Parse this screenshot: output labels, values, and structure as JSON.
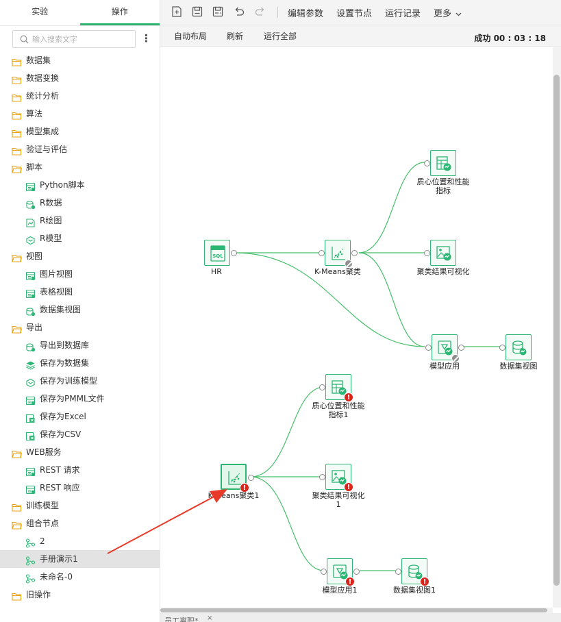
{
  "tabs": [
    "实验",
    "操作"
  ],
  "search": {
    "placeholder": "输入搜索文字"
  },
  "tree": [
    {
      "label": "数据集",
      "icon": "folder-icon",
      "level": 0
    },
    {
      "label": "数据变换",
      "icon": "folder-icon",
      "level": 0
    },
    {
      "label": "统计分析",
      "icon": "folder-icon",
      "level": 0
    },
    {
      "label": "算法",
      "icon": "folder-icon",
      "level": 0
    },
    {
      "label": "模型集成",
      "icon": "folder-icon",
      "level": 0
    },
    {
      "label": "验证与评估",
      "icon": "folder-icon",
      "level": 0
    },
    {
      "label": "脚本",
      "icon": "folder-open-icon",
      "level": 0
    },
    {
      "label": "Python脚本",
      "icon": "python-script-icon",
      "level": 1
    },
    {
      "label": "R数据",
      "icon": "r-data-icon",
      "level": 1
    },
    {
      "label": "R绘图",
      "icon": "r-plot-icon",
      "level": 1
    },
    {
      "label": "R模型",
      "icon": "r-model-icon",
      "level": 1
    },
    {
      "label": "视图",
      "icon": "folder-open-icon",
      "level": 0
    },
    {
      "label": "图片视图",
      "icon": "image-view-icon",
      "level": 1
    },
    {
      "label": "表格视图",
      "icon": "table-view-icon",
      "level": 1
    },
    {
      "label": "数据集视图",
      "icon": "dataset-view-icon",
      "level": 1
    },
    {
      "label": "导出",
      "icon": "folder-open-icon",
      "level": 0
    },
    {
      "label": "导出到数据库",
      "icon": "export-db-icon",
      "level": 1
    },
    {
      "label": "保存为数据集",
      "icon": "save-dataset-icon",
      "level": 1
    },
    {
      "label": "保存为训练模型",
      "icon": "save-model-icon",
      "level": 1
    },
    {
      "label": "保存为PMML文件",
      "icon": "save-pmml-icon",
      "level": 1
    },
    {
      "label": "保存为Excel",
      "icon": "save-excel-icon",
      "level": 1
    },
    {
      "label": "保存为CSV",
      "icon": "save-csv-icon",
      "level": 1
    },
    {
      "label": "WEB服务",
      "icon": "folder-open-icon",
      "level": 0
    },
    {
      "label": "REST 请求",
      "icon": "rest-request-icon",
      "level": 1
    },
    {
      "label": "REST 响应",
      "icon": "rest-response-icon",
      "level": 1
    },
    {
      "label": "训练模型",
      "icon": "folder-icon",
      "level": 0
    },
    {
      "label": "组合节点",
      "icon": "folder-open-icon",
      "level": 0
    },
    {
      "label": "2",
      "icon": "combo-node-icon",
      "level": 1
    },
    {
      "label": "手册演示1",
      "icon": "combo-node-icon",
      "level": 1,
      "selected": true
    },
    {
      "label": "未命名-0",
      "icon": "combo-node-icon",
      "level": 1
    },
    {
      "label": "旧操作",
      "icon": "folder-icon",
      "level": 0
    }
  ],
  "toolbar": {
    "icons": [
      "new-icon",
      "save-icon",
      "save-as-icon",
      "undo-icon",
      "redo-icon"
    ],
    "edit_params": "编辑参数",
    "set_node": "设置节点",
    "run_log": "运行记录",
    "more": "更多"
  },
  "subbar": {
    "auto_layout": "自动布局",
    "refresh": "刷新",
    "run_all": "运行全部",
    "status": "成功 00 : 03 : 18"
  },
  "bottom_tab": {
    "label": "员工离职*",
    "close": "×"
  },
  "nodes": [
    {
      "id": "hr",
      "label": "HR",
      "icon": "sql-icon",
      "status": "none"
    },
    {
      "id": "kmeans",
      "label": "K-Means聚类",
      "icon": "kmeans-icon",
      "status": "stopped"
    },
    {
      "id": "centroid",
      "label": "质心位置和性能\n指标",
      "icon": "table-chart-icon",
      "status": "none"
    },
    {
      "id": "vis",
      "label": "聚类结果可视化",
      "icon": "image-chart-icon",
      "status": "none"
    },
    {
      "id": "apply",
      "label": "模型应用",
      "icon": "model-apply-icon",
      "status": "stopped"
    },
    {
      "id": "dsview",
      "label": "数据集视图",
      "icon": "dataset-view-icon",
      "status": "none"
    },
    {
      "id": "kmeans1",
      "label": "K-Means聚类1",
      "icon": "kmeans-icon",
      "status": "error",
      "selected": true
    },
    {
      "id": "centroid1",
      "label": "质心位置和性能\n指标1",
      "icon": "table-chart-icon",
      "status": "error"
    },
    {
      "id": "vis1",
      "label": "聚类结果可视化\n1",
      "icon": "image-chart-icon",
      "status": "error"
    },
    {
      "id": "apply1",
      "label": "模型应用1",
      "icon": "model-apply-icon",
      "status": "error"
    },
    {
      "id": "dsview1",
      "label": "数据集视图1",
      "icon": "dataset-view-icon",
      "status": "error"
    }
  ],
  "colors": {
    "accent": "#2bb673",
    "error": "#d9261c",
    "arrow": "#e83a2a"
  }
}
